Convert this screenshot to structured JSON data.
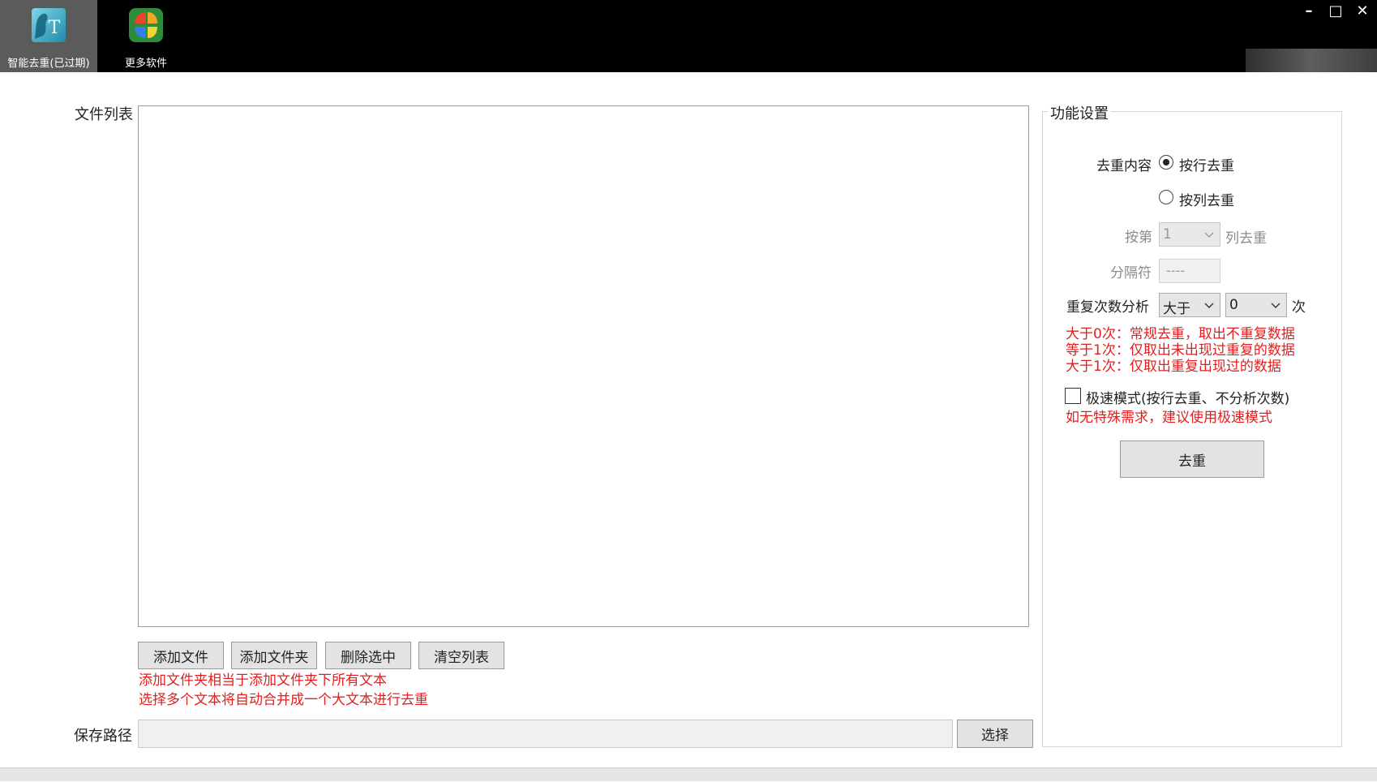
{
  "topbar": {
    "nav": [
      {
        "label": "智能去重(已过期)",
        "icon": "text-dedup-app-icon",
        "active": true
      },
      {
        "label": "更多软件",
        "icon": "more-software-icon",
        "active": false
      }
    ],
    "window_controls": {
      "minimize": "–",
      "maximize": "□",
      "close": "✕"
    }
  },
  "file_section": {
    "label": "文件列表",
    "files": [],
    "buttons": {
      "add_file": "添加文件",
      "add_folder": "添加文件夹",
      "delete_selected": "删除选中",
      "clear_list": "清空列表"
    },
    "notes": [
      "添加文件夹相当于添加文件夹下所有文本",
      "选择多个文本将自动合并成一个大文本进行去重"
    ]
  },
  "save_path": {
    "label": "保存路径",
    "value": "",
    "choose_button": "选择"
  },
  "settings": {
    "title": "功能设置",
    "dedup_content_label": "去重内容",
    "radio_by_line": "按行去重",
    "radio_by_column": "按列去重",
    "selected_mode": "by_line",
    "column_prefix": "按第",
    "column_value": "1",
    "column_suffix": "列去重",
    "separator_label": "分隔符",
    "separator_value": "----",
    "repeat_label": "重复次数分析",
    "repeat_compare": "大于",
    "repeat_count": "0",
    "repeat_unit": "次",
    "hints": [
      "大于0次：常规去重，取出不重复数据",
      "等于1次：仅取出未出现过重复的数据",
      "大于1次：仅取出重复出现过的数据"
    ],
    "fast_mode_label": "极速模式(按行去重、不分析次数)",
    "fast_mode_checked": false,
    "fast_mode_hint": "如无特殊需求，建议使用极速模式",
    "run_button": "去重"
  },
  "colors": {
    "topbar_bg": "#000000",
    "active_nav_bg": "#5b5b5b",
    "hint_red": "#e02020",
    "button_bg": "#e3e3e3"
  }
}
